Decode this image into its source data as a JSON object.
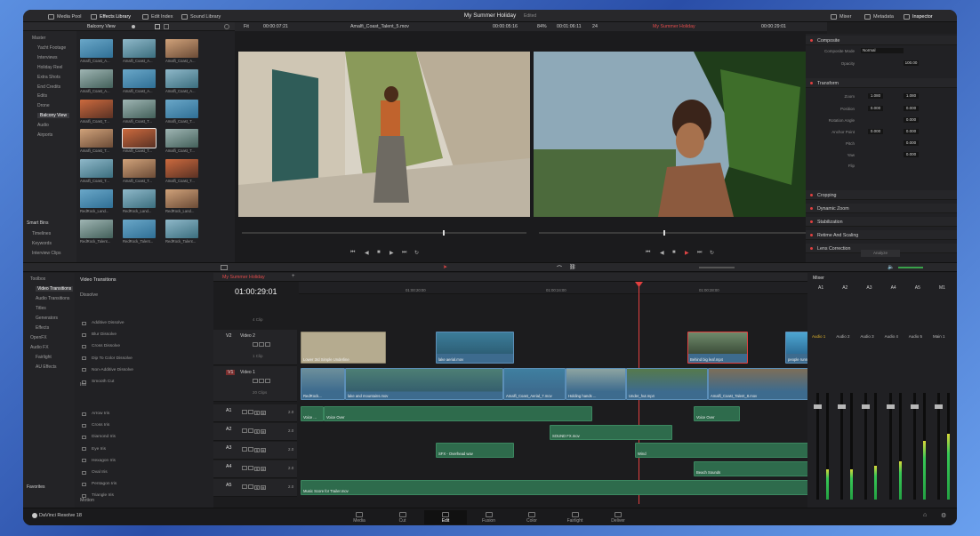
{
  "app": {
    "title": "My Summer Holiday",
    "status": "Edited",
    "brand": "DaVinci Resolve 18"
  },
  "toolbar": {
    "media_pool": "Media Pool",
    "effects_library": "Effects Library",
    "edit_index": "Edit Index",
    "sound_library": "Sound Library",
    "mixer": "Mixer",
    "metadata": "Metadata",
    "inspector": "Inspector"
  },
  "bin": {
    "current": "Balcony View",
    "tree": [
      "Master",
      "Yacht Footage",
      "Interviews",
      "Holiday Reel",
      "Extra Shots",
      "End Credits",
      "Edits",
      "Drone",
      "Balcony View",
      "Audio",
      "Airports"
    ],
    "smart_bins": "Smart Bins",
    "smart_items": [
      "Timelines",
      "Keywords",
      "Interview Clips"
    ]
  },
  "clips": [
    "Amalfi_Coast_A...",
    "Amalfi_Coast_A...",
    "Amalfi_Coast_A...",
    "Amalfi_Coast_A...",
    "Amalfi_Coast_A...",
    "Amalfi_Coast_A...",
    "Amalfi_Coast_T...",
    "Amalfi_Coast_T...",
    "Amalfi_Coast_T...",
    "Amalfi_Coast_T...",
    "Amalfi_Coast_T...",
    "Amalfi_Coast_T...",
    "Amalfi_Coast_T...",
    "Amalfi_Coast_T...",
    "Amalfi_Coast_T...",
    "RedRock_Land...",
    "RedRock_Land...",
    "RedRock_Land...",
    "RedRock_Talent...",
    "RedRock_Talent...",
    "RedRock_Talent..."
  ],
  "source": {
    "zoom": "Fit",
    "timecode": "00:00:07:21",
    "clip": "Amalfi_Coast_Talent_5.mov",
    "duration": "00:00:05:16"
  },
  "record": {
    "zoom": "84%",
    "timecode": "00:01:06:11",
    "fps": "24",
    "timeline": "My Summer Holiday",
    "tc": "00:00:29:01"
  },
  "inspector": {
    "sections": [
      "Composite",
      "Transform",
      "Cropping",
      "Dynamic Zoom",
      "Stabilization",
      "Retime And Scaling",
      "Lens Correction"
    ],
    "composite_mode_label": "Composite Mode",
    "composite_mode": "Normal",
    "opacity_label": "Opacity",
    "opacity": "100.00",
    "zoom_label": "Zoom",
    "zoom_x": "1.080",
    "zoom_y": "1.080",
    "position_label": "Position",
    "position_x": "0.000",
    "position_y": "0.000",
    "rotation_label": "Rotation Angle",
    "rotation": "0.000",
    "anchor_label": "Anchor Point",
    "anchor_x": "0.000",
    "anchor_y": "0.000",
    "pitch_label": "Pitch",
    "pitch": "0.000",
    "yaw_label": "Yaw",
    "yaw": "0.000",
    "flip_label": "Flip",
    "analyze": "Analyze"
  },
  "toolbox": {
    "items": [
      "Toolbox",
      "Video Transitions",
      "Audio Transitions",
      "Titles",
      "Generators",
      "Effects",
      "OpenFX",
      "Audio FX",
      "Fairlight",
      "AU Effects"
    ],
    "favorites": "Favorites"
  },
  "transitions": {
    "header": "Video Transitions",
    "dissolve_group": "Dissolve",
    "dissolve": [
      "Additive Dissolve",
      "Blur Dissolve",
      "Cross Dissolve",
      "Dip To Color Dissolve",
      "Non-Additive Dissolve",
      "Smooth Cut"
    ],
    "iris_group": "Iris",
    "iris": [
      "Arrow Iris",
      "Cross Iris",
      "Diamond Iris",
      "Eye Iris",
      "Hexagon Iris",
      "Oval Iris",
      "Pentagon Iris",
      "Triangle Iris"
    ],
    "motion_group": "Motion"
  },
  "timeline": {
    "tab": "My Summer Holiday",
    "tc": "01:00:29:01",
    "ruler": [
      "01:00:20:00",
      "01:00:24:00",
      "01:00:28:00"
    ],
    "tracks": [
      {
        "id": "V2",
        "name": "Video 2",
        "count": "1 Clip"
      },
      {
        "id": "V1",
        "name": "Video 1",
        "count": "20 Clips"
      },
      {
        "id": "A1",
        "vol": "2.0"
      },
      {
        "id": "A2",
        "vol": "2.0"
      },
      {
        "id": "A3",
        "vol": "2.0"
      },
      {
        "id": "A4",
        "vol": "2.0"
      },
      {
        "id": "A5",
        "vol": "2.0"
      }
    ],
    "v2_top_count": "4 Clip",
    "clips": {
      "v2a": "Lower 3rd Simple Underline",
      "v2b": "lake aerial.mov",
      "v2c": "Behind big leaf.mp4",
      "v2d": "people running.mov",
      "v1a": "RedRock...",
      "v1b": "lake and mountains.mov",
      "v1c": "Amalfi_Coast_Aerial_7.mov",
      "v1d": "Holding hands ...",
      "v1e": "Under_hut.mp4",
      "v1f": "Amalfi_Coast_Talent_8.mov",
      "a1a": "Voice ...",
      "a1b": "Voice Over",
      "a1c": "Voice Over",
      "a2a": "SOUND FX.mov",
      "a3a": "SFX - Overhead wav",
      "a3b": "Wind",
      "a4a": "Beach Sounds",
      "a5a": "Music Score for Trailer.mov"
    }
  },
  "mixer": {
    "title": "Mixer",
    "channels": [
      "A1",
      "A2",
      "A3",
      "A4",
      "A5",
      "M1"
    ],
    "labels": [
      "Audio 1",
      "Audio 2",
      "Audio 3",
      "Audio 4",
      "Audio 5",
      "Main 1"
    ],
    "levels": [
      0.28,
      0.28,
      0.32,
      0.36,
      0.55,
      0.62
    ]
  },
  "pages": [
    "Media",
    "Cut",
    "Edit",
    "Fusion",
    "Color",
    "Fairlight",
    "Deliver"
  ],
  "active_page": "Edit"
}
